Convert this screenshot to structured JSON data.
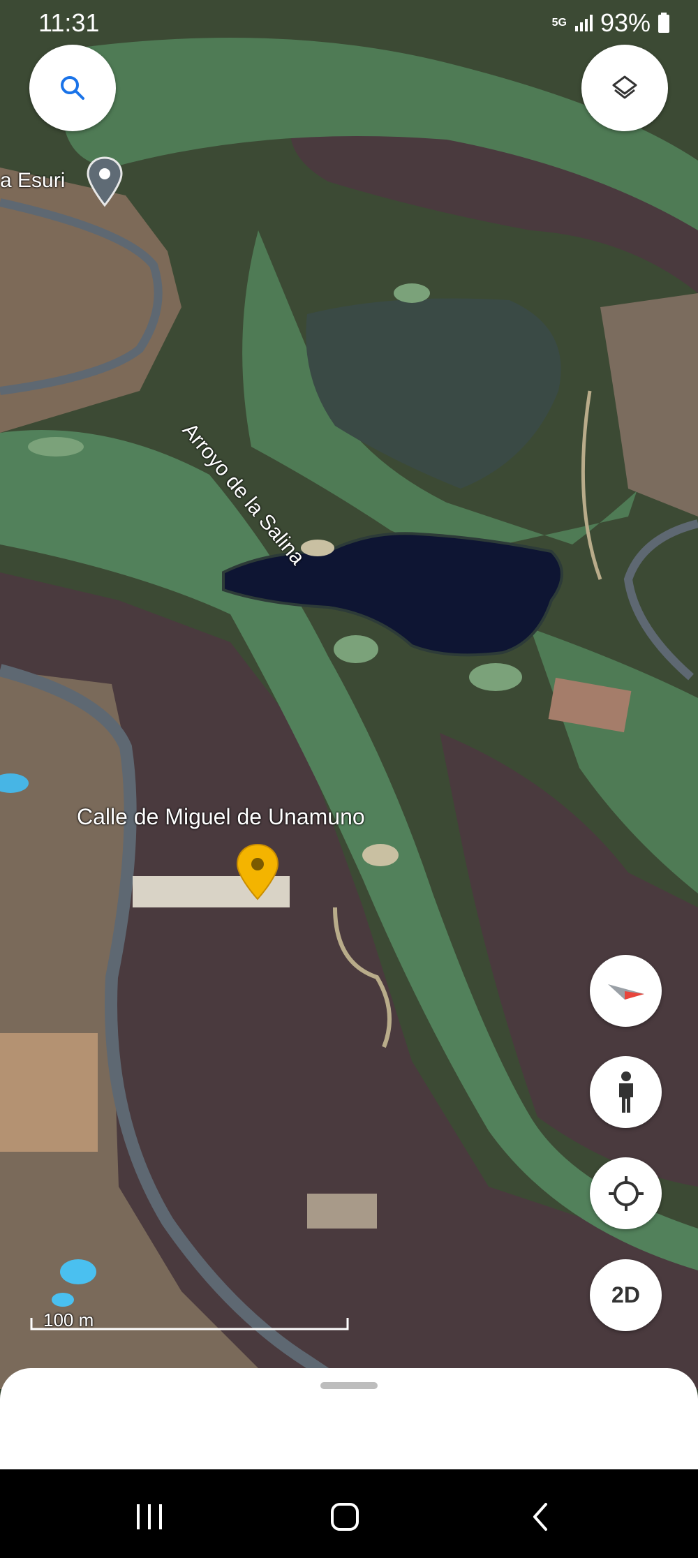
{
  "status_bar": {
    "time": "11:31",
    "network": "5G",
    "battery": "93%"
  },
  "map": {
    "labels": {
      "place_left": "a Esuri",
      "stream": "Arroyo de la Salina",
      "street": "Calle de Miguel de Unamuno"
    },
    "scale": "100 m"
  },
  "controls": {
    "search_icon": "search-icon",
    "layers_icon": "layers-icon",
    "compass_icon": "compass-icon",
    "pegman_icon": "pegman-icon",
    "location_icon": "my-location-icon",
    "view_toggle": "2D"
  },
  "colors": {
    "fairway": "#4f7b55",
    "brush": "#4a3a3e",
    "water": "#0e1533",
    "marker": "#f4b400",
    "compass_red": "#e8453c"
  },
  "nav_bar": {
    "recent": "recent-apps-icon",
    "home": "home-icon",
    "back": "back-icon"
  }
}
